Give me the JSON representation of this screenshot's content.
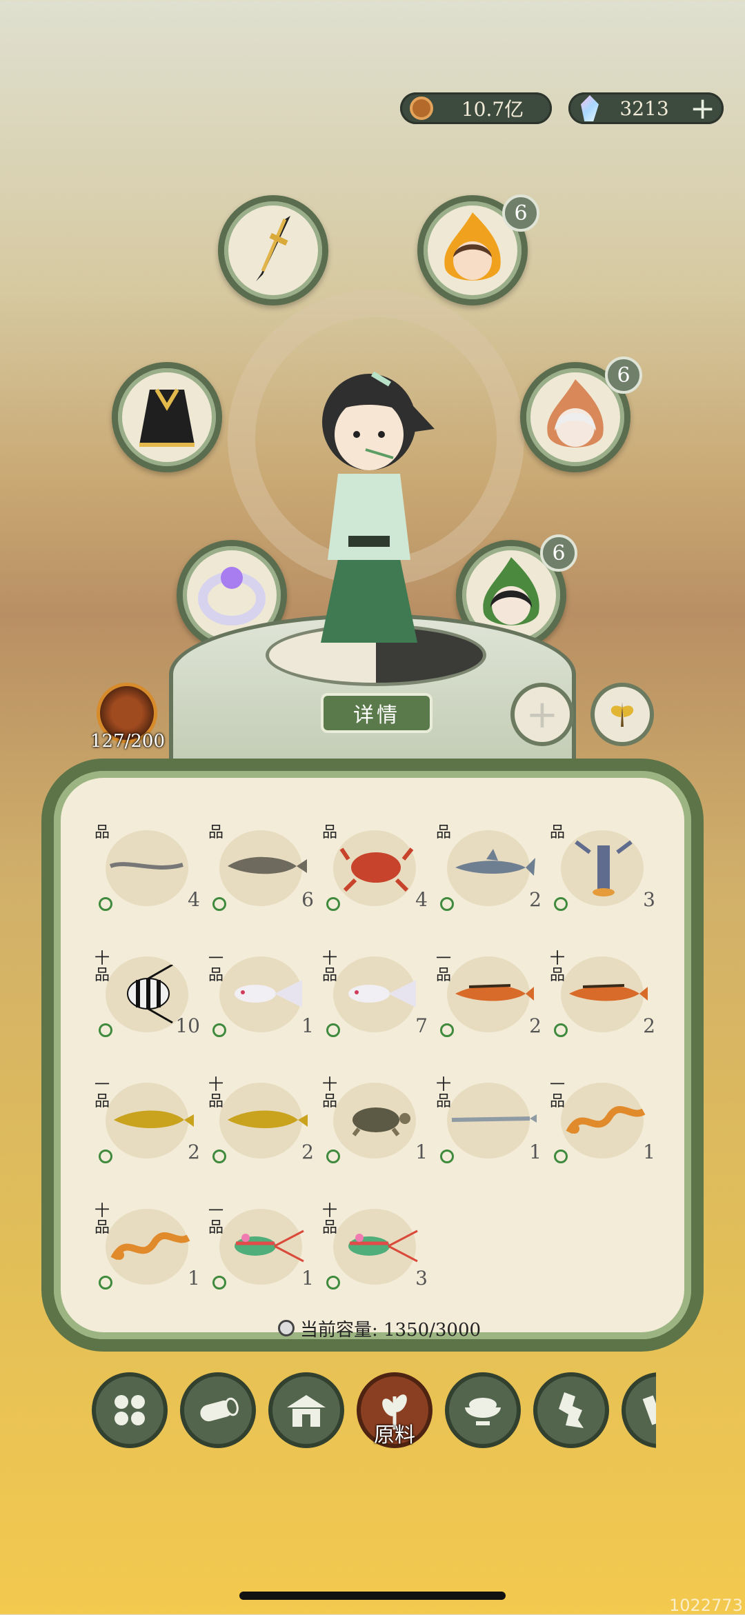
{
  "currency": {
    "coins": "10.7亿",
    "gems": "3213",
    "coin_icon": "coin-icon",
    "gem_icon": "crystal-icon",
    "add_icon": "plus-icon"
  },
  "slots": [
    {
      "name": "weapon",
      "icon": "sword-icon"
    },
    {
      "name": "pet-fire-girl",
      "icon": "fire-spirit-icon",
      "badge": "6"
    },
    {
      "name": "armor",
      "icon": "armor-icon"
    },
    {
      "name": "pet-white-hair",
      "icon": "white-hair-spirit-icon",
      "badge": "6"
    },
    {
      "name": "ring",
      "icon": "ring-icon"
    },
    {
      "name": "pet-green",
      "icon": "green-spirit-icon",
      "badge": "6"
    }
  ],
  "details_label": "详情",
  "stamina": "127/200",
  "inventory": {
    "rows": [
      [
        {
          "g": "品",
          "c": "4",
          "t": "eel"
        },
        {
          "g": "品",
          "c": "6",
          "t": "catfish"
        },
        {
          "g": "品",
          "c": "4",
          "t": "crab"
        },
        {
          "g": "品",
          "c": "2",
          "t": "shark"
        },
        {
          "g": "品",
          "c": "3",
          "t": "lobster"
        }
      ],
      [
        {
          "g": "十品",
          "c": "10",
          "t": "angelfish"
        },
        {
          "g": "一品",
          "c": "1",
          "t": "guppy"
        },
        {
          "g": "十品",
          "c": "7",
          "t": "guppy"
        },
        {
          "g": "一品",
          "c": "2",
          "t": "redfish"
        },
        {
          "g": "十品",
          "c": "2",
          "t": "redfish"
        }
      ],
      [
        {
          "g": "一品",
          "c": "2",
          "t": "arowana"
        },
        {
          "g": "十品",
          "c": "2",
          "t": "arowana"
        },
        {
          "g": "十品",
          "c": "1",
          "t": "turtle"
        },
        {
          "g": "十品",
          "c": "1",
          "t": "needlefish"
        },
        {
          "g": "一品",
          "c": "1",
          "t": "dragon"
        }
      ],
      [
        {
          "g": "十品",
          "c": "1",
          "t": "dragon"
        },
        {
          "g": "一品",
          "c": "1",
          "t": "rainbowfish"
        },
        {
          "g": "十品",
          "c": "3",
          "t": "rainbowfish"
        }
      ]
    ],
    "capacity_label": "当前容量: 1350/3000"
  },
  "nav": [
    {
      "icon": "grid-icon"
    },
    {
      "icon": "log-icon"
    },
    {
      "icon": "house-icon"
    },
    {
      "icon": "wheat-icon",
      "label": "原料",
      "active": true
    },
    {
      "icon": "bowl-icon"
    },
    {
      "icon": "map-icon"
    },
    {
      "icon": "scroll-icon"
    }
  ],
  "watermark": "1022773"
}
